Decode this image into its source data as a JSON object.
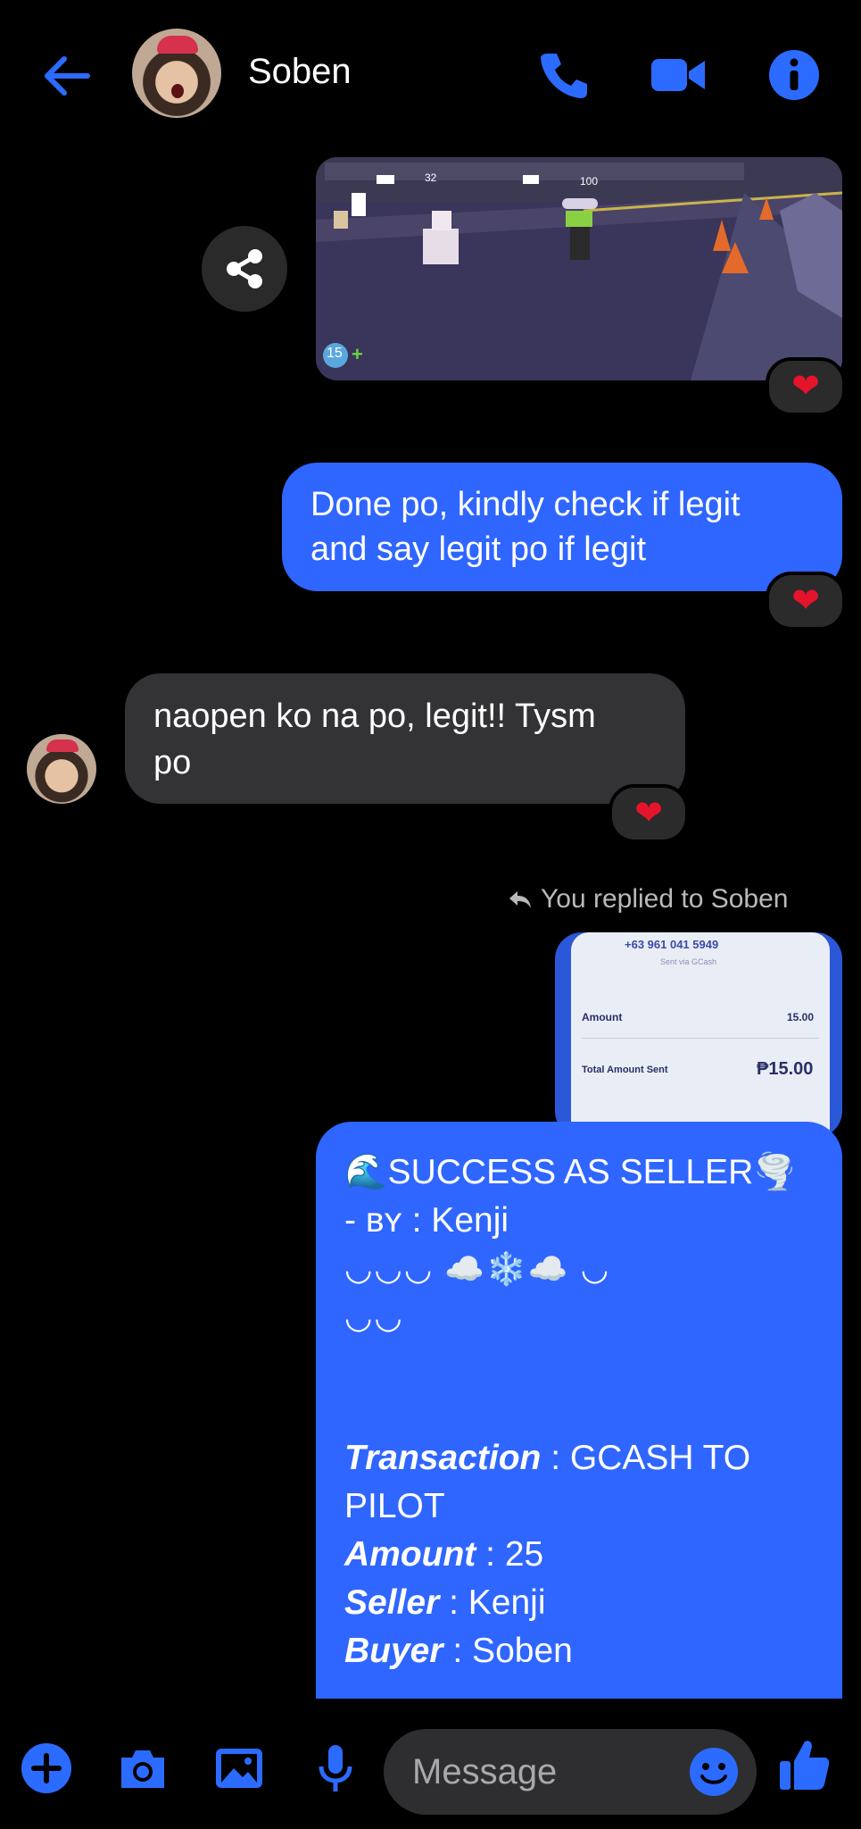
{
  "header": {
    "contact_name": "Soben"
  },
  "messages": {
    "sent_1": {
      "line1": "Done po, kindly check if legit",
      "line2": "and say legit po if legit"
    },
    "received_1": {
      "line1": "naopen ko na po, legit!! Tysm",
      "line2": "po"
    },
    "reply_note": "You replied to Soben",
    "receipt_preview": {
      "number": "+63 961 041 5949",
      "sent_via": "Sent via GCash",
      "amount_label": "Amount",
      "amount_value": "15.00",
      "total_label": "Total Amount Sent",
      "total_value": "₱15.00"
    },
    "sent_2": {
      "title": "🌊SUCCESS AS SELLER🌪️",
      "by_line": "- ʙʏ : Kenji",
      "deco1": "◡◡◡ ☁️❄️☁️ ◡",
      "deco2": "◡◡",
      "transaction_key": "Transaction",
      "transaction_val": " : GCASH TO",
      "transaction_val2": "PILOT",
      "amount_key": "Amount",
      "amount_val": " : 25",
      "seller_key": "Seller",
      "seller_val": " : Kenji",
      "buyer_key": "Buyer",
      "buyer_val": " : Soben"
    }
  },
  "composer": {
    "placeholder": "Message"
  },
  "game_overlay": {
    "badge": "15",
    "num1": "32",
    "num2": "100"
  },
  "colors": {
    "accent": "#2f66ff",
    "icon_blue": "#2c6bff",
    "reaction_red": "#e5142b"
  },
  "icons": {
    "back": "arrow-left-icon",
    "call": "phone-icon",
    "video": "video-camera-icon",
    "info": "info-icon",
    "share": "share-icon",
    "reaction": "heart-icon",
    "reply": "reply-arrow-icon",
    "add": "plus-circle-icon",
    "camera": "camera-icon",
    "gallery": "image-icon",
    "mic": "microphone-icon",
    "emoji": "smiley-icon",
    "like": "thumbs-up-icon"
  }
}
